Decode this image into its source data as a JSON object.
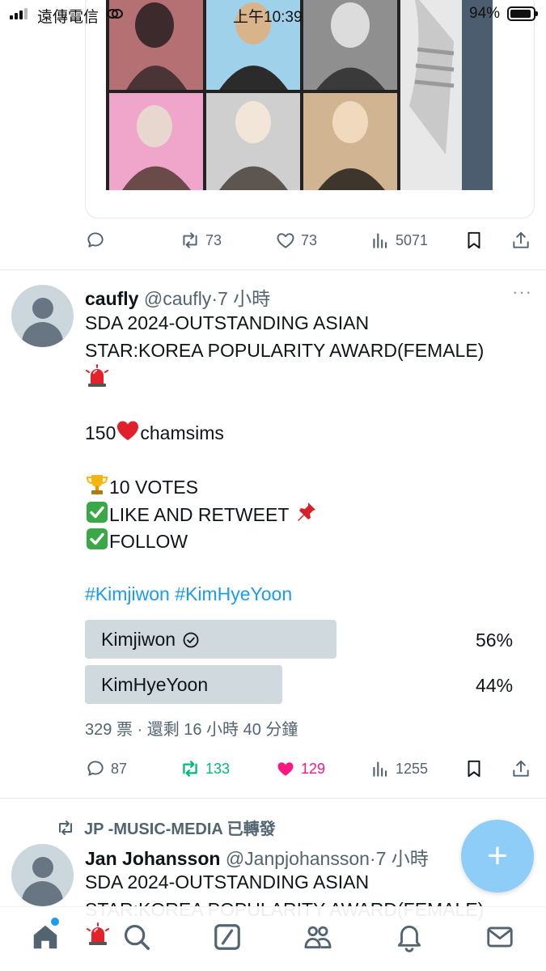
{
  "status_bar": {
    "carrier": "遠傳電信",
    "time": "上午10:39",
    "battery": "94%",
    "battery_level": 0.94
  },
  "previous_tweet": {
    "actions": {
      "reply_count": "",
      "retweet_count": "73",
      "like_count": "73",
      "views_count": "5071"
    }
  },
  "tweet": {
    "name": "caufly",
    "handle": "@caufly",
    "separator": "·",
    "time": "7 小時",
    "text_lines": {
      "l1": "SDA 2024-OUTSTANDING ASIAN",
      "l2": "STAR:KOREA POPULARITY AWARD(FEMALE)",
      "l3_pre": "150",
      "l3_post": "chamsims",
      "l4": "10 VOTES",
      "l5": "LIKE AND RETWEET",
      "l6": "FOLLOW"
    },
    "hashtags": "#Kimjiwon #KimHyeYoon",
    "poll": {
      "options": [
        {
          "label": "Kimjiwon",
          "percent_text": "56%",
          "percent": 56,
          "selected": true
        },
        {
          "label": "KimHyeYoon",
          "percent_text": "44%",
          "percent": 44,
          "selected": false
        }
      ],
      "meta": "329 票 · 還剩 16 小時 40 分鐘"
    },
    "actions": {
      "reply_count": "87",
      "retweet_count": "133",
      "like_count": "129",
      "views_count": "1255"
    },
    "colors": {
      "retweet_active": "#00ba7c",
      "like_active": "#f91880",
      "link": "#1d9bf0",
      "muted": "#536471"
    }
  },
  "next_tweet": {
    "retweet_context": "JP -MUSIC-MEDIA 已轉發",
    "name": "Jan Johansson",
    "handle": "@Janpjohansson",
    "separator": "·",
    "time": "7 小時",
    "text_l1": "SDA 2024-OUTSTANDING ASIAN",
    "text_l2": "STAR:KOREA POPULARITY AWARD(FEMALE)"
  },
  "fab": {
    "label": "+",
    "icon": "plus-icon"
  },
  "bottom_nav": {
    "items": [
      "home-icon",
      "search-icon",
      "grok-icon",
      "communities-icon",
      "notifications-icon",
      "messages-icon"
    ]
  }
}
